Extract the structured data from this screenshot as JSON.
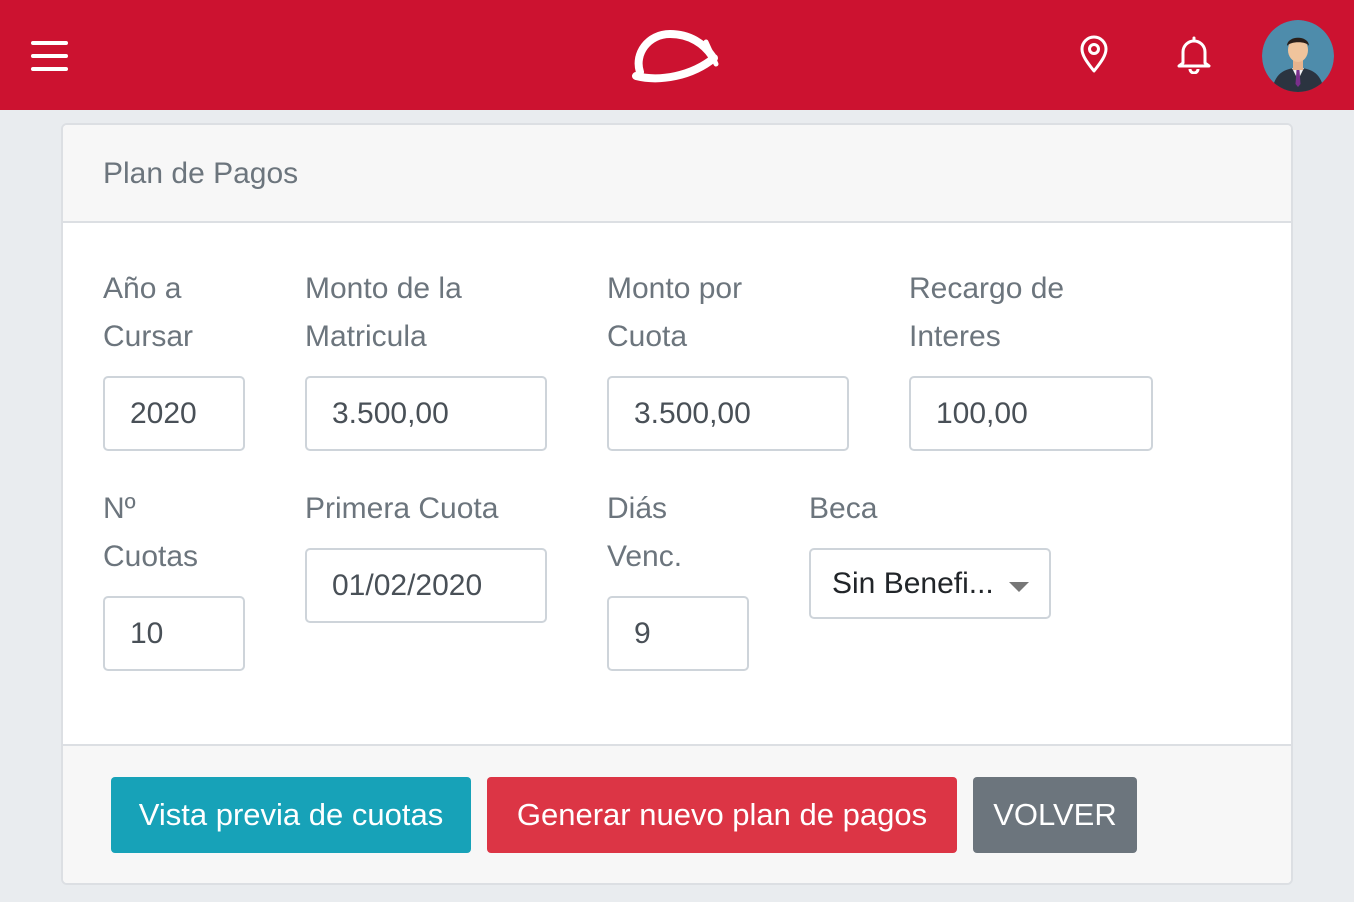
{
  "header": {
    "brand_color": "#cc1230",
    "icons": [
      "menu-icon",
      "brand-logo",
      "location-pin-icon",
      "bell-icon",
      "user-avatar"
    ]
  },
  "card": {
    "title": "Plan de Pagos",
    "fields": {
      "anio": {
        "label1": "Año a",
        "label2": "Cursar",
        "value": "2020"
      },
      "matricula": {
        "label1": "Monto de la",
        "label2": "Matricula",
        "value": "3.500,00"
      },
      "cuota": {
        "label1": "Monto por",
        "label2": "Cuota",
        "value": "3.500,00"
      },
      "recargo": {
        "label1": "Recargo de",
        "label2": "Interes",
        "value": "100,00"
      },
      "ncuotas": {
        "label1": "Nº",
        "label2": "Cuotas",
        "value": "10"
      },
      "primera": {
        "label1": "Primera Cuota",
        "value": "01/02/2020"
      },
      "dias": {
        "label1": "Diás",
        "label2": "Venc.",
        "value": "9"
      },
      "beca": {
        "label1": "Beca",
        "value": "Sin Benefi..."
      }
    },
    "buttons": {
      "preview": "Vista previa de cuotas",
      "generate": "Generar nuevo plan de pagos",
      "back": "VOLVER"
    }
  }
}
